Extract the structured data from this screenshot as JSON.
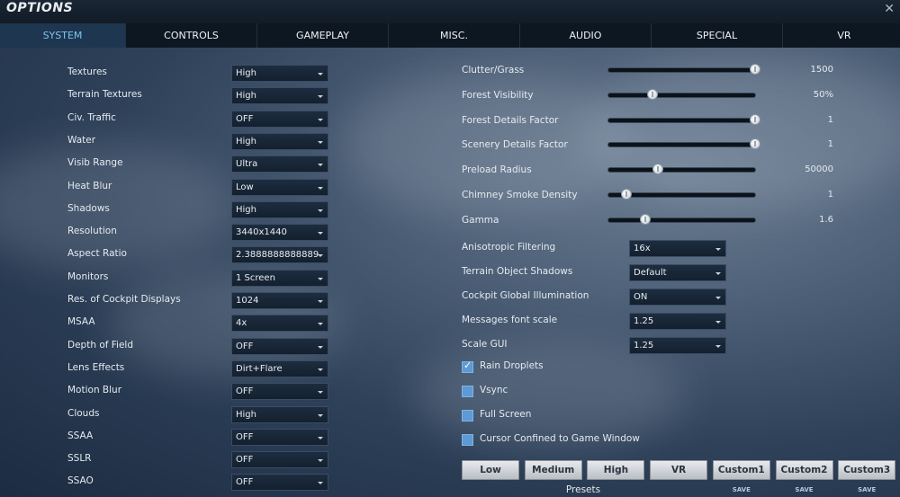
{
  "window": {
    "title": "OPTIONS"
  },
  "tabs": [
    {
      "label": "SYSTEM",
      "active": true,
      "w": 139
    },
    {
      "label": "CONTROLS",
      "active": false,
      "w": 145
    },
    {
      "label": "GAMEPLAY",
      "active": false,
      "w": 145
    },
    {
      "label": "MISC.",
      "active": false,
      "w": 145
    },
    {
      "label": "AUDIO",
      "active": false,
      "w": 145
    },
    {
      "label": "SPECIAL",
      "active": false,
      "w": 145
    },
    {
      "label": "VR",
      "active": false,
      "w": 136
    }
  ],
  "left_settings": [
    {
      "label": "Textures",
      "value": "High"
    },
    {
      "label": "Terrain Textures",
      "value": "High"
    },
    {
      "label": "Civ. Traffic",
      "value": "OFF"
    },
    {
      "label": "Water",
      "value": "High"
    },
    {
      "label": "Visib Range",
      "value": "Ultra"
    },
    {
      "label": "Heat Blur",
      "value": "Low"
    },
    {
      "label": "Shadows",
      "value": "High"
    },
    {
      "label": "Resolution",
      "value": "3440x1440"
    },
    {
      "label": "Aspect Ratio",
      "value": "2.3888888888889"
    },
    {
      "label": "Monitors",
      "value": "1 Screen"
    },
    {
      "label": "Res. of Cockpit Displays",
      "value": "1024"
    },
    {
      "label": "MSAA",
      "value": "4x"
    },
    {
      "label": "Depth of Field",
      "value": "OFF"
    },
    {
      "label": "Lens Effects",
      "value": "Dirt+Flare"
    },
    {
      "label": "Motion Blur",
      "value": "OFF"
    },
    {
      "label": "Clouds",
      "value": "High"
    },
    {
      "label": "SSAA",
      "value": "OFF"
    },
    {
      "label": "SSLR",
      "value": "OFF"
    },
    {
      "label": "SSAO",
      "value": "OFF"
    }
  ],
  "sliders": [
    {
      "label": "Clutter/Grass",
      "value": "1500",
      "level": 1.0
    },
    {
      "label": "Forest Visibility",
      "value": "50%",
      "level": 0.3
    },
    {
      "label": "Forest Details Factor",
      "value": "1",
      "level": 1.0
    },
    {
      "label": "Scenery Details Factor",
      "value": "1",
      "level": 1.0
    },
    {
      "label": "Preload Radius",
      "value": "50000",
      "level": 0.34
    },
    {
      "label": "Chimney Smoke Density",
      "value": "1",
      "level": 0.12
    },
    {
      "label": "Gamma",
      "value": "1.6",
      "level": 0.25
    }
  ],
  "right_dropdowns": [
    {
      "label": "Anisotropic Filtering",
      "value": "16x"
    },
    {
      "label": "Terrain Object Shadows",
      "value": "Default"
    },
    {
      "label": "Cockpit Global Illumination",
      "value": "ON"
    },
    {
      "label": "Messages font scale",
      "value": "1.25"
    },
    {
      "label": "Scale GUI",
      "value": "1.25"
    }
  ],
  "checkboxes": [
    {
      "label": "Rain Droplets",
      "checked": true
    },
    {
      "label": "Vsync",
      "checked": false
    },
    {
      "label": "Full Screen",
      "checked": false
    },
    {
      "label": "Cursor Confined to Game Window",
      "checked": false
    }
  ],
  "presets": {
    "label": "Presets",
    "buttons": [
      "Low",
      "Medium",
      "High",
      "VR",
      "Custom1",
      "Custom2",
      "Custom3"
    ],
    "save_label": "SAVE"
  }
}
